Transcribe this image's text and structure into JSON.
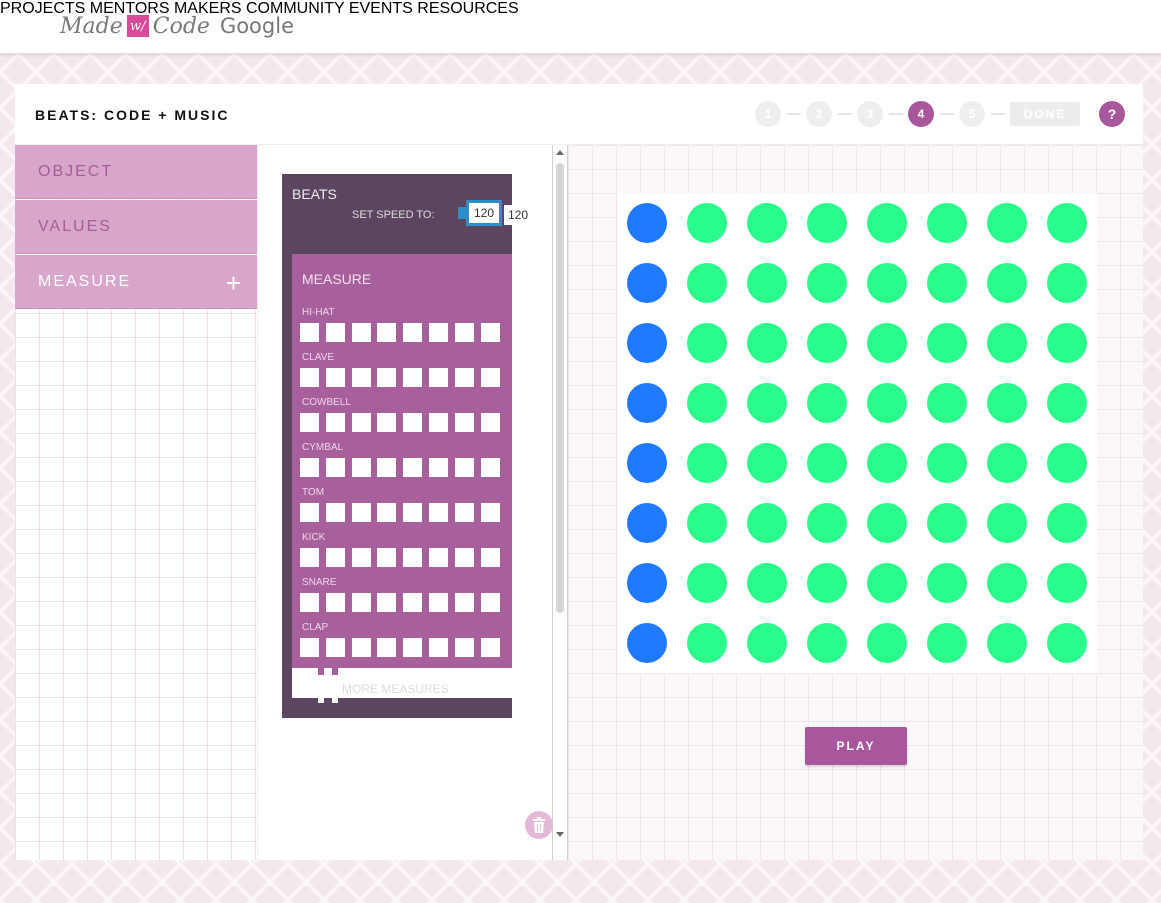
{
  "logo": {
    "made": "Made",
    "with": "w/",
    "code": "Code",
    "google": "Google"
  },
  "nav": [
    "PROJECTS",
    "MENTORS",
    "MAKERS",
    "COMMUNITY",
    "EVENTS",
    "RESOURCES"
  ],
  "project": {
    "title": "BEATS: CODE + MUSIC",
    "steps": [
      "1",
      "2",
      "3",
      "4",
      "5"
    ],
    "active_step": 4,
    "done_label": "DONE",
    "help_label": "?"
  },
  "categories": [
    "OBJECT",
    "VALUES",
    "MEASURE"
  ],
  "selected_category": "MEASURE",
  "blocks": {
    "beats_label": "BEATS",
    "speed_label": "SET SPEED TO:",
    "speed_value": "120",
    "speed_tooltip": "120",
    "measure_label": "MEASURE",
    "instruments": [
      "HI-HAT",
      "CLAVE",
      "COWBELL",
      "CYMBAL",
      "TOM",
      "KICK",
      "SNARE",
      "CLAP"
    ],
    "more_measures": "MORE MEASURES"
  },
  "preview": {
    "rows": 8,
    "cols": 8,
    "active_column": 0,
    "active_color": "#1f7aff",
    "inactive_color": "#29fc8a",
    "play_label": "PLAY"
  },
  "colors": {
    "accent": "#a9579c",
    "block_dark": "#5c4561",
    "block_measure": "#a8609c",
    "category": "#d8a6cb"
  }
}
